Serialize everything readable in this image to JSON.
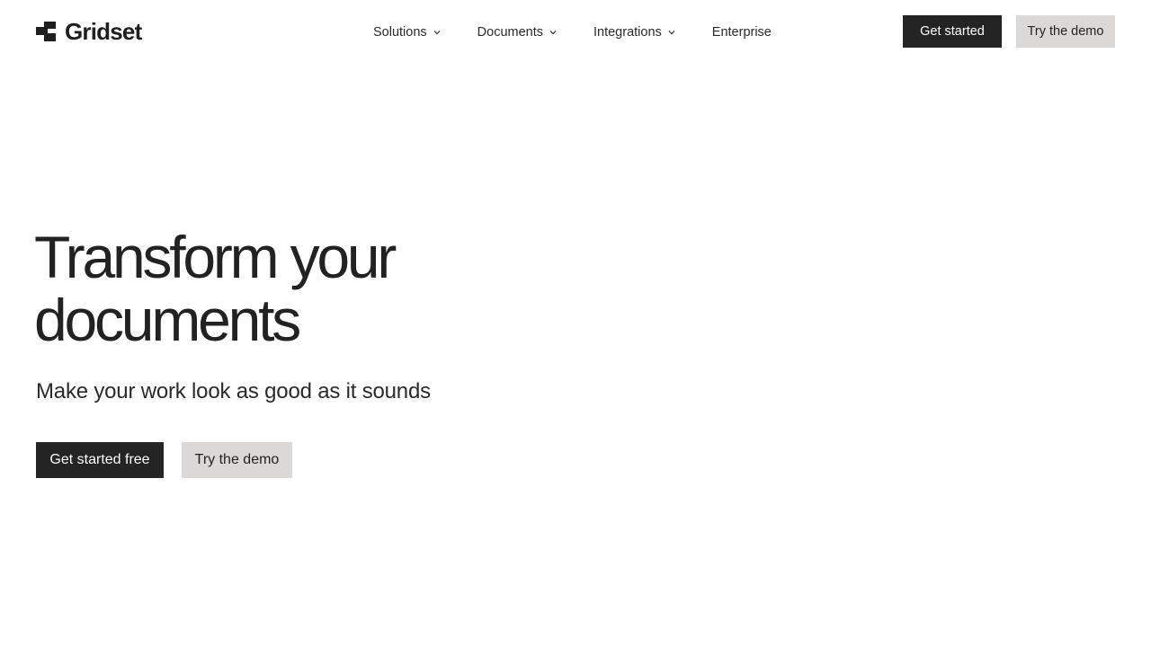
{
  "header": {
    "logo_text": "Gridset",
    "logo_icon": "gridset-logo-mark",
    "nav": [
      {
        "label": "Solutions",
        "has_dropdown": true
      },
      {
        "label": "Documents",
        "has_dropdown": true
      },
      {
        "label": "Integrations",
        "has_dropdown": true
      },
      {
        "label": "Enterprise",
        "has_dropdown": false
      }
    ],
    "get_started_label": "Get started",
    "demo_label": "Try the demo"
  },
  "hero": {
    "title_line1": "Transform your",
    "title_line2": "documents",
    "subtitle": "Make your work look as good as it sounds",
    "primary_cta": "Get started free",
    "secondary_cta": "Try the demo"
  },
  "colors": {
    "text_primary": "#222222",
    "button_dark": "#242424",
    "button_light": "#dcd8d5",
    "background": "#ffffff"
  }
}
